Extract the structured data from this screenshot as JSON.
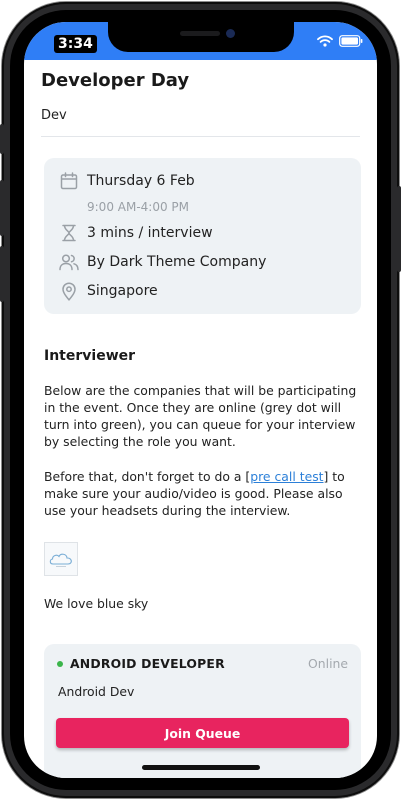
{
  "status_bar": {
    "time": "3:34",
    "color": "#2f7ef6",
    "icons": [
      "wifi-icon",
      "battery-icon"
    ]
  },
  "event": {
    "title": "Developer Day",
    "subtitle": "Dev"
  },
  "details": {
    "date": "Thursday 6 Feb",
    "time_range": "9:00 AM-4:00 PM",
    "duration": "3 mins / interview",
    "organizer": "By Dark Theme Company",
    "location": "Singapore",
    "icons": [
      "calendar-icon",
      "hourglass-icon",
      "people-icon",
      "location-pin-icon"
    ]
  },
  "interviewer": {
    "heading": "Interviewer",
    "paragraph1": "Below are the companies that will be participating in the event. Once they are online (grey dot will turn into green), you can queue for your interview by selecting the role you want.",
    "paragraph2_before": "Before that, don't forget to do a [",
    "paragraph2_link": "pre call test",
    "paragraph2_after": "] to make sure your audio/video is good. Please also use your headsets during the interview.",
    "logo_caption": "We love blue sky"
  },
  "job": {
    "title": "ANDROID DEVELOPER",
    "status": "Online",
    "status_color": "#3bb54a",
    "description": "Android Dev",
    "button_label": "Join Queue",
    "button_color": "#e8245f"
  }
}
